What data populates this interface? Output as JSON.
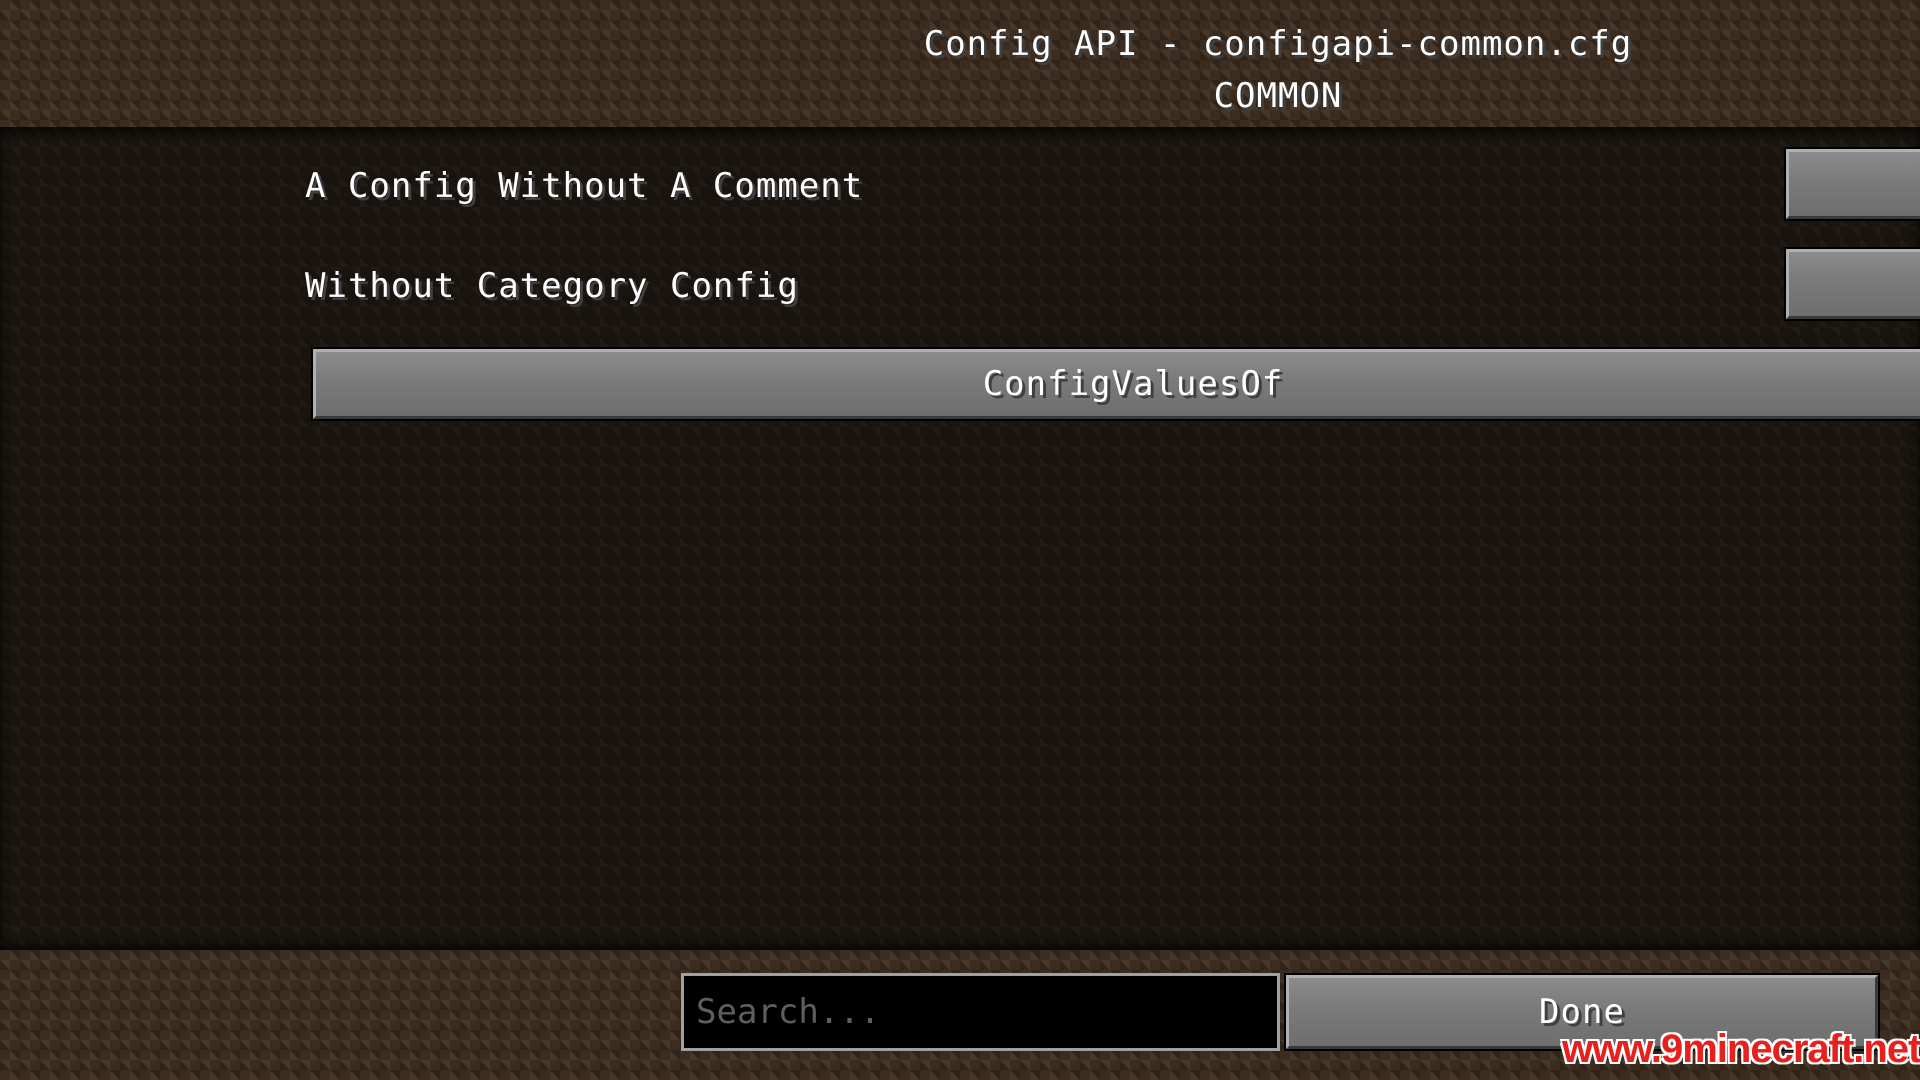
{
  "header": {
    "title": "Config API - configapi-common.cfg",
    "subtitle": "COMMON"
  },
  "entries": [
    {
      "label": "A Config Without A Comment"
    },
    {
      "label": "Without Category Config"
    }
  ],
  "category_button": {
    "label": "ConfigValuesOf"
  },
  "footer": {
    "search_placeholder": "Search...",
    "done_label": "Done"
  },
  "watermark": {
    "text": "www.9minecraft.net"
  }
}
